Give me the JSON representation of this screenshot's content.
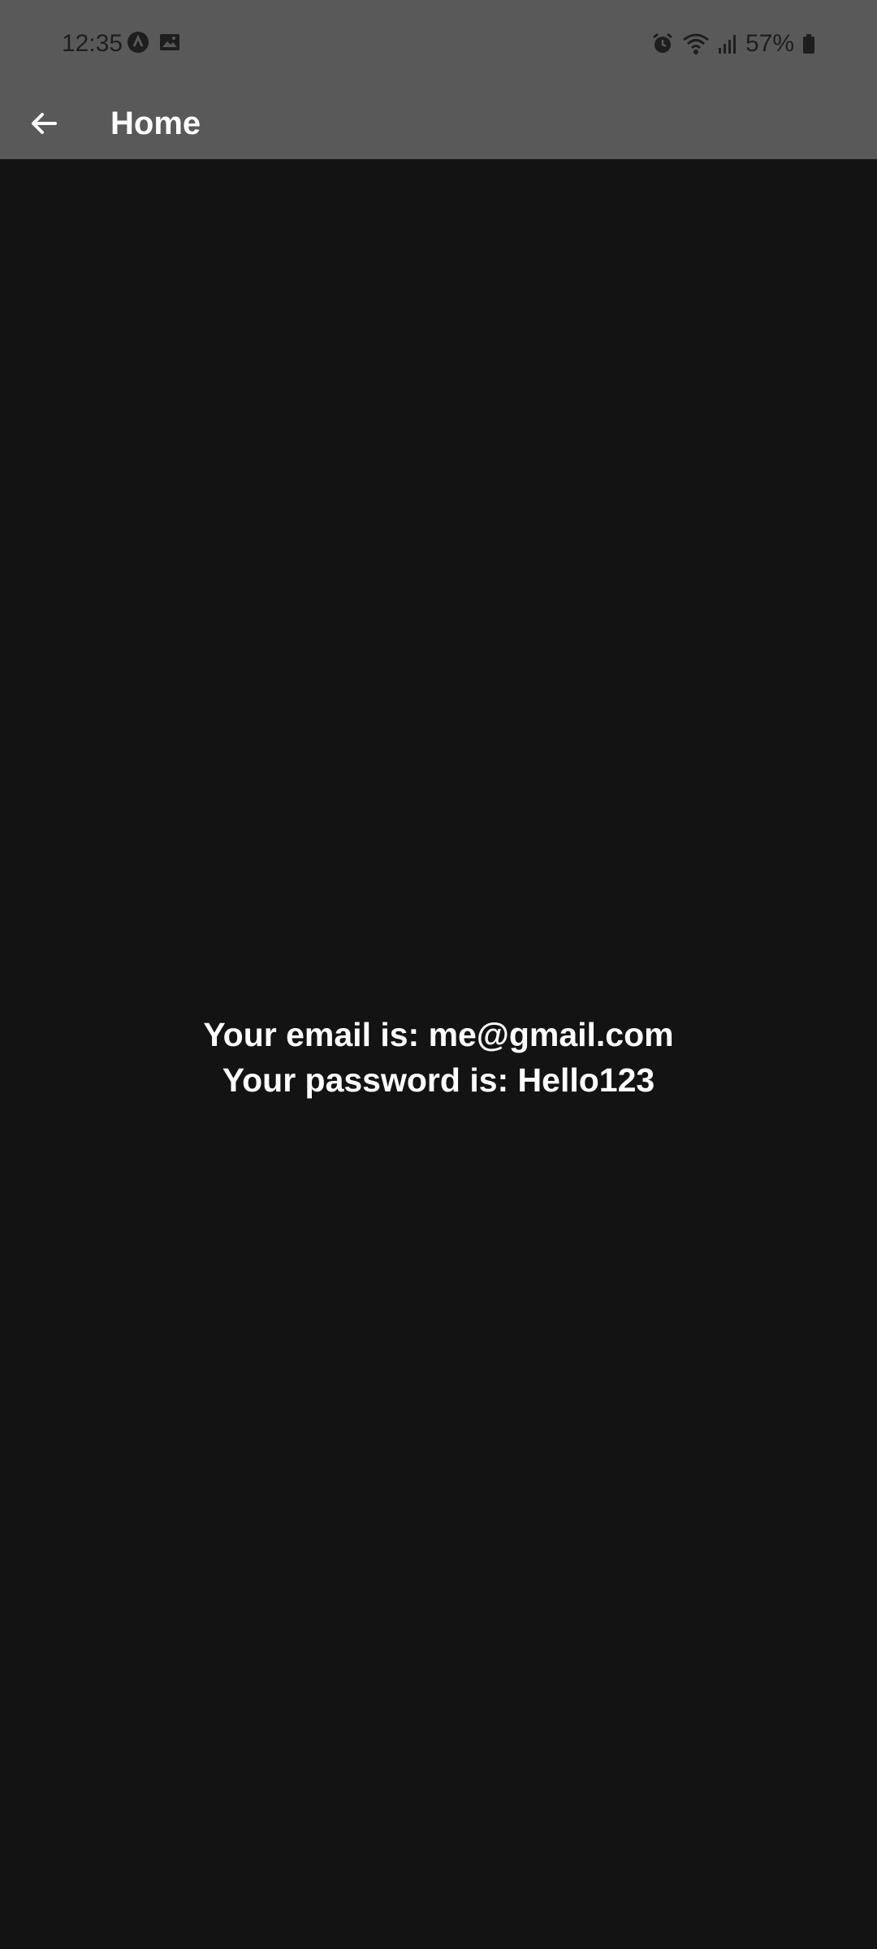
{
  "status_bar": {
    "time": "12:35",
    "left_icons": [
      "app-notification-icon",
      "image-icon"
    ],
    "right_icons": [
      "alarm-icon",
      "wifi-icon",
      "signal-icon"
    ],
    "battery_percent": "57%"
  },
  "app_bar": {
    "back_icon": "arrow-back-icon",
    "title": "Home"
  },
  "content": {
    "email_line": "Your email is: me@gmail.com",
    "password_line": "Your password is: Hello123"
  },
  "colors": {
    "background": "#131313",
    "bars": "#595959",
    "text": "#ffffff"
  }
}
